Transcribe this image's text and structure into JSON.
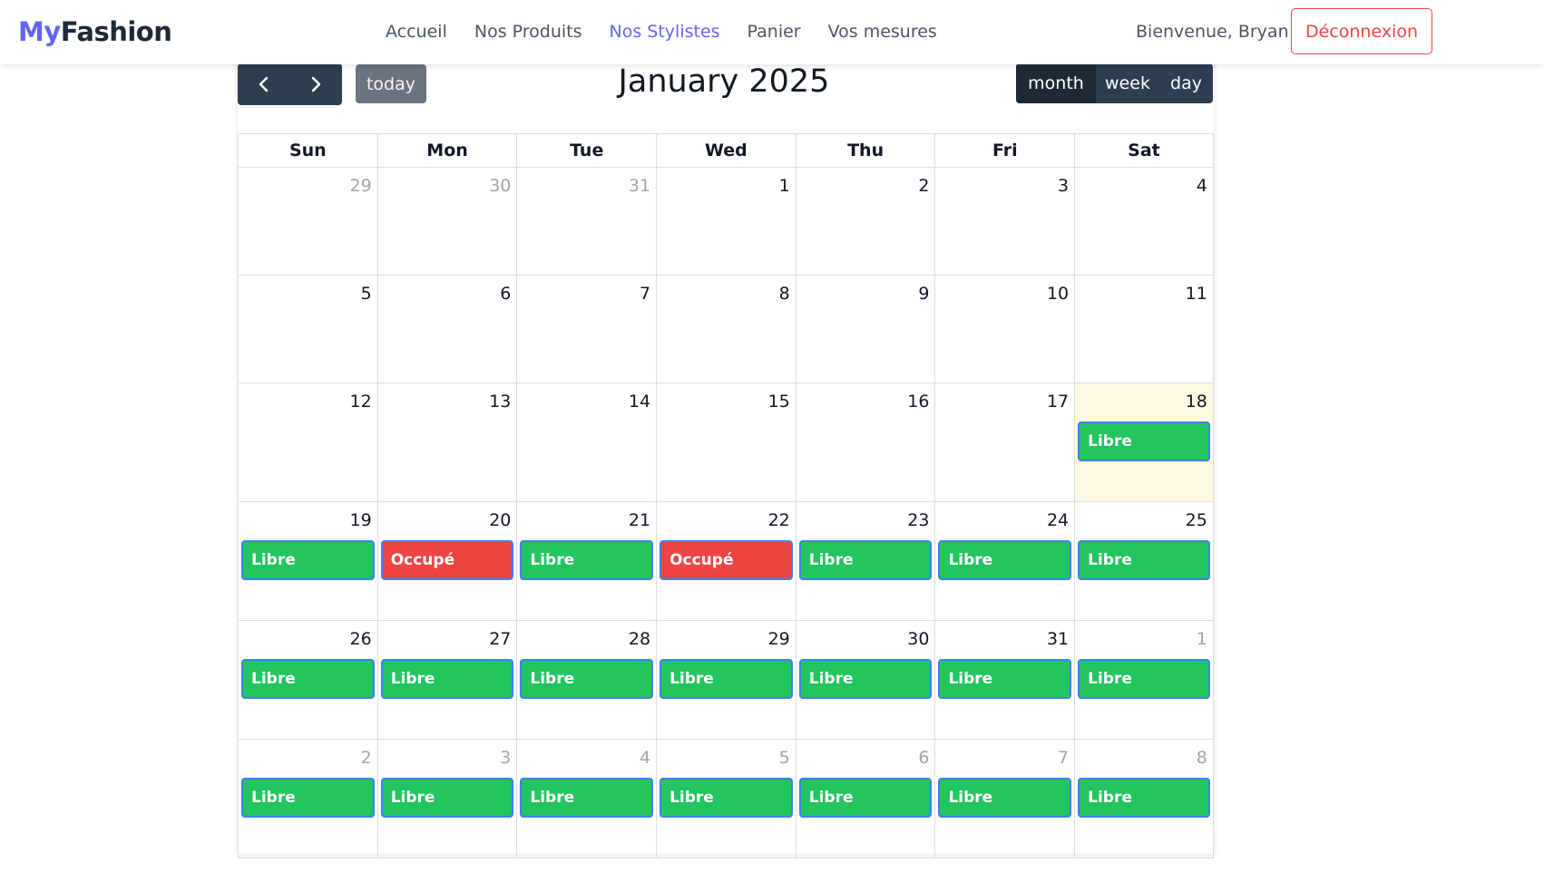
{
  "brand": {
    "part1": "My",
    "part2": "Fashion"
  },
  "nav": {
    "items": [
      {
        "label": "Accueil",
        "active": false
      },
      {
        "label": "Nos Produits",
        "active": false
      },
      {
        "label": "Nos Stylistes",
        "active": true
      },
      {
        "label": "Panier",
        "active": false
      },
      {
        "label": "Vos mesures",
        "active": false
      }
    ],
    "welcome": "Bienvenue, Bryan",
    "logout": "Déconnexion"
  },
  "calendar": {
    "title": "January 2025",
    "today_label": "today",
    "views": [
      {
        "label": "month",
        "active": true
      },
      {
        "label": "week",
        "active": false
      },
      {
        "label": "day",
        "active": false
      }
    ],
    "weekdays": [
      "Sun",
      "Mon",
      "Tue",
      "Wed",
      "Thu",
      "Fri",
      "Sat"
    ],
    "weeks": [
      [
        {
          "d": "29",
          "o": true
        },
        {
          "d": "30",
          "o": true
        },
        {
          "d": "31",
          "o": true
        },
        {
          "d": "1"
        },
        {
          "d": "2"
        },
        {
          "d": "3"
        },
        {
          "d": "4"
        }
      ],
      [
        {
          "d": "5"
        },
        {
          "d": "6"
        },
        {
          "d": "7"
        },
        {
          "d": "8"
        },
        {
          "d": "9"
        },
        {
          "d": "10"
        },
        {
          "d": "11"
        }
      ],
      [
        {
          "d": "12"
        },
        {
          "d": "13"
        },
        {
          "d": "14"
        },
        {
          "d": "15"
        },
        {
          "d": "16"
        },
        {
          "d": "17"
        },
        {
          "d": "18",
          "today": true,
          "ev": "Libre"
        }
      ],
      [
        {
          "d": "19",
          "ev": "Libre"
        },
        {
          "d": "20",
          "ev": "Occupé"
        },
        {
          "d": "21",
          "ev": "Libre"
        },
        {
          "d": "22",
          "ev": "Occupé"
        },
        {
          "d": "23",
          "ev": "Libre"
        },
        {
          "d": "24",
          "ev": "Libre"
        },
        {
          "d": "25",
          "ev": "Libre"
        }
      ],
      [
        {
          "d": "26",
          "ev": "Libre"
        },
        {
          "d": "27",
          "ev": "Libre"
        },
        {
          "d": "28",
          "ev": "Libre"
        },
        {
          "d": "29",
          "ev": "Libre"
        },
        {
          "d": "30",
          "ev": "Libre"
        },
        {
          "d": "31",
          "ev": "Libre"
        },
        {
          "d": "1",
          "o": true,
          "ev": "Libre"
        }
      ],
      [
        {
          "d": "2",
          "o": true,
          "ev": "Libre"
        },
        {
          "d": "3",
          "o": true,
          "ev": "Libre"
        },
        {
          "d": "4",
          "o": true,
          "ev": "Libre"
        },
        {
          "d": "5",
          "o": true,
          "ev": "Libre"
        },
        {
          "d": "6",
          "o": true,
          "ev": "Libre"
        },
        {
          "d": "7",
          "o": true,
          "ev": "Libre"
        },
        {
          "d": "8",
          "o": true,
          "ev": "Libre"
        }
      ]
    ]
  },
  "colors": {
    "accent": "#6366f1",
    "libre": "#22c55e",
    "occupe": "#ef4444",
    "toolbar": "#2c3e50",
    "today_bg": "#fef9e0"
  }
}
